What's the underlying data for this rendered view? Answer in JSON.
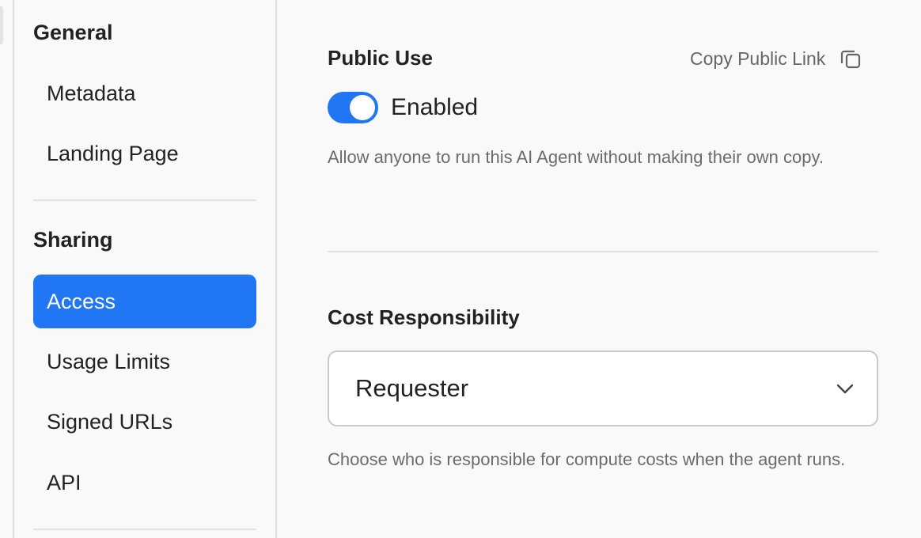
{
  "sidebar": {
    "sections": [
      {
        "title": "General",
        "items": [
          "Metadata",
          "Landing Page"
        ]
      },
      {
        "title": "Sharing",
        "items": [
          "Access",
          "Usage Limits",
          "Signed URLs",
          "API"
        ]
      }
    ],
    "active_item": "Access"
  },
  "public_use": {
    "title": "Public Use",
    "copy_link_label": "Copy Public Link",
    "toggle_state": true,
    "toggle_label": "Enabled",
    "help_text": "Allow anyone to run this AI Agent without making their own copy."
  },
  "cost_responsibility": {
    "title": "Cost Responsibility",
    "selected_value": "Requester",
    "help_text": "Choose who is responsible for compute costs when the agent runs."
  },
  "colors": {
    "accent": "#2176f4",
    "text": "#222222",
    "muted_text": "#6b6b6b",
    "divider": "#e2e2e2"
  },
  "icons": {
    "copy": "copy-icon",
    "dropdown": "chevron-down-icon"
  }
}
